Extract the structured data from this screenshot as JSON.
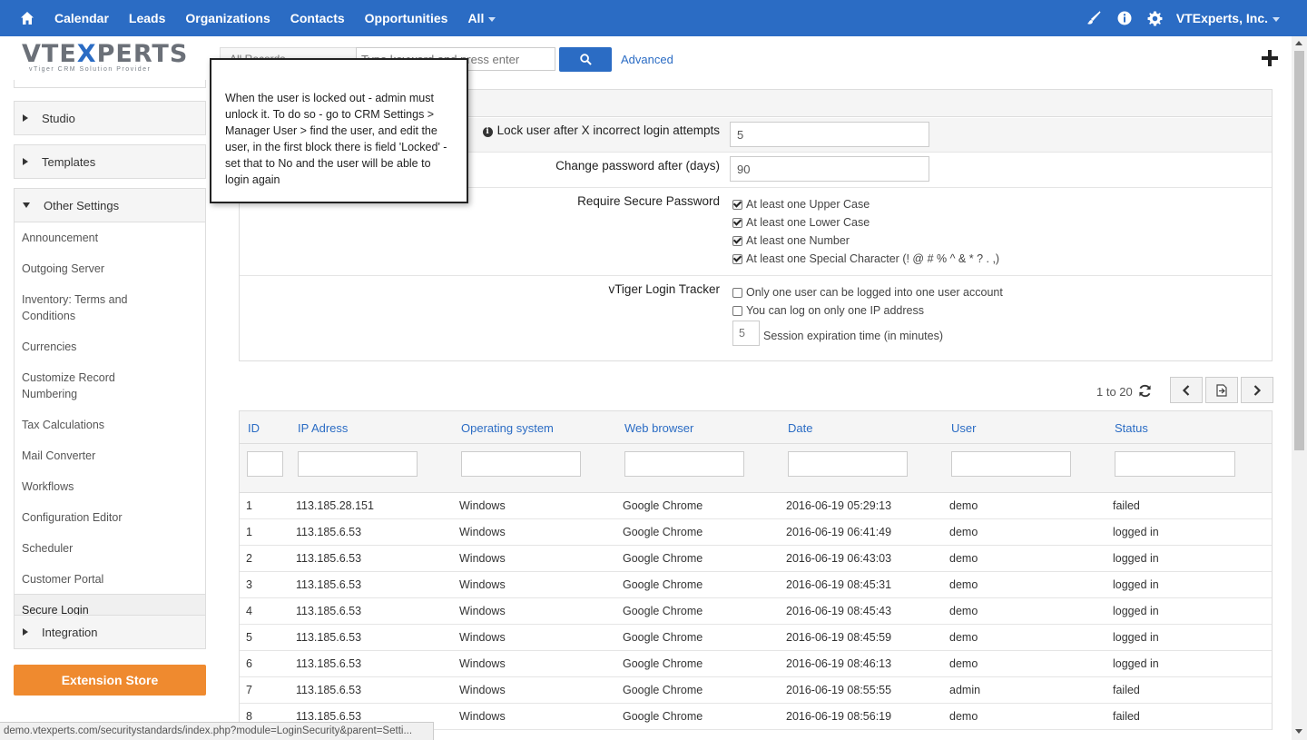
{
  "nav": {
    "items": [
      "Calendar",
      "Leads",
      "Organizations",
      "Contacts",
      "Opportunities",
      "All"
    ],
    "company": "VTExperts, Inc."
  },
  "logo": {
    "main_left": "VTE",
    "main_x": "X",
    "main_right": "PERTS",
    "sub": "vTiger CRM Solution Provider"
  },
  "search": {
    "select_value": "All Records",
    "placeholder": "Type keyword and press enter",
    "advanced_label": "Advanced"
  },
  "sidebar": {
    "sections": {
      "studio": "Studio",
      "templates": "Templates",
      "other_settings": "Other Settings",
      "integration": "Integration"
    },
    "other_items": [
      "Announcement",
      "Outgoing Server",
      "Inventory: Terms and Conditions",
      "Currencies",
      "Customize Record Numbering",
      "Tax Calculations",
      "Mail Converter",
      "Workflows",
      "Configuration Editor",
      "Scheduler",
      "Customer Portal",
      "Secure Login"
    ],
    "extension_store": "Extension Store"
  },
  "tooltip": {
    "text": "When the user is locked out - admin must unlock it. To do so - go to CRM Settings > Manager User > find the user, and edit the user, in the first block there is field 'Locked' - set that to No and the user will be able to login again"
  },
  "settings": {
    "lock_label": "Lock user after X incorrect login attempts",
    "lock_value": "5",
    "change_pw_label": "Change password after (days)",
    "change_pw_value": "90",
    "secure_pw_label": "Require Secure Password",
    "secure_pw_options": [
      "At least one Upper Case",
      "At least one Lower Case",
      "At least one Number",
      "At least one Special Character (! @ # % ^ & * ? . ,)"
    ],
    "tracker_label": "vTiger Login Tracker",
    "tracker_options": [
      "Only one user can be logged into one user account",
      "You can log on only one IP address"
    ],
    "session_value": "5",
    "session_label": "Session expiration time (in minutes)"
  },
  "pagination": {
    "range": "1 to 20"
  },
  "table": {
    "headers": [
      "ID",
      "IP Adress",
      "Operating system",
      "Web browser",
      "Date",
      "User",
      "Status"
    ],
    "rows": [
      [
        "1",
        "113.185.28.151",
        "Windows",
        "Google Chrome",
        "2016-06-19 05:29:13",
        "demo",
        "failed"
      ],
      [
        "1",
        "113.185.6.53",
        "Windows",
        "Google Chrome",
        "2016-06-19 06:41:49",
        "demo",
        "logged in"
      ],
      [
        "2",
        "113.185.6.53",
        "Windows",
        "Google Chrome",
        "2016-06-19 06:43:03",
        "demo",
        "logged in"
      ],
      [
        "3",
        "113.185.6.53",
        "Windows",
        "Google Chrome",
        "2016-06-19 08:45:31",
        "demo",
        "logged in"
      ],
      [
        "4",
        "113.185.6.53",
        "Windows",
        "Google Chrome",
        "2016-06-19 08:45:43",
        "demo",
        "logged in"
      ],
      [
        "5",
        "113.185.6.53",
        "Windows",
        "Google Chrome",
        "2016-06-19 08:45:59",
        "demo",
        "logged in"
      ],
      [
        "6",
        "113.185.6.53",
        "Windows",
        "Google Chrome",
        "2016-06-19 08:46:13",
        "demo",
        "logged in"
      ],
      [
        "7",
        "113.185.6.53",
        "Windows",
        "Google Chrome",
        "2016-06-19 08:55:55",
        "admin",
        "failed"
      ],
      [
        "8",
        "113.185.6.53",
        "Windows",
        "Google Chrome",
        "2016-06-19 08:56:19",
        "demo",
        "failed"
      ]
    ]
  },
  "statusbar": {
    "url": "demo.vtexperts.com/securitystandards/index.php?module=LoginSecurity&parent=Setti..."
  },
  "colors": {
    "brand_blue": "#2b6cc4",
    "extension_orange": "#ef8a2f"
  }
}
